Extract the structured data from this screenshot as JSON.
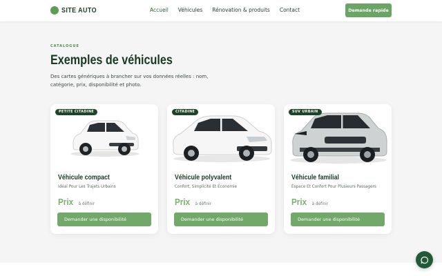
{
  "header": {
    "brand": "SITE AUTO",
    "nav": [
      "Accueil",
      "Véhicules",
      "Rénovation & produits",
      "Contact"
    ],
    "cta": "Demande rapide"
  },
  "section": {
    "eyebrow": "CATALOGUE",
    "title": "Exemples de véhicules",
    "description": "Des cartes génériques à brancher sur vos données réelles : nom, catégorie, prix, disponibilité et photo."
  },
  "cards": [
    {
      "badge": "PETITE CITADINE",
      "title": "Véhicule compact",
      "subtitle": "Idéal Pour Les Trajets Urbains",
      "price_label": "Prix",
      "price_note": "à définir",
      "button": "Demander une disponibilité",
      "image_icon": "car-compact-icon"
    },
    {
      "badge": "CITADINE",
      "title": "Véhicule polyvalent",
      "subtitle": "Confort, Simplicité Et Économie",
      "price_label": "Prix",
      "price_note": "à définir",
      "button": "Demander une disponibilité",
      "image_icon": "car-hatchback-icon"
    },
    {
      "badge": "SUV URBAIN",
      "title": "Véhicule familial",
      "subtitle": "Espace Et Confort Pour Plusieurs Passagers",
      "price_label": "Prix",
      "price_note": "à définir",
      "button": "Demander une disponibilité",
      "image_icon": "car-suv-icon"
    }
  ],
  "colors": {
    "primary": "#6aa566",
    "dark_green": "#1f4328",
    "price_green": "#7bb06f",
    "background": "#f4f5f4"
  },
  "fab": {
    "icon": "chat-icon"
  }
}
